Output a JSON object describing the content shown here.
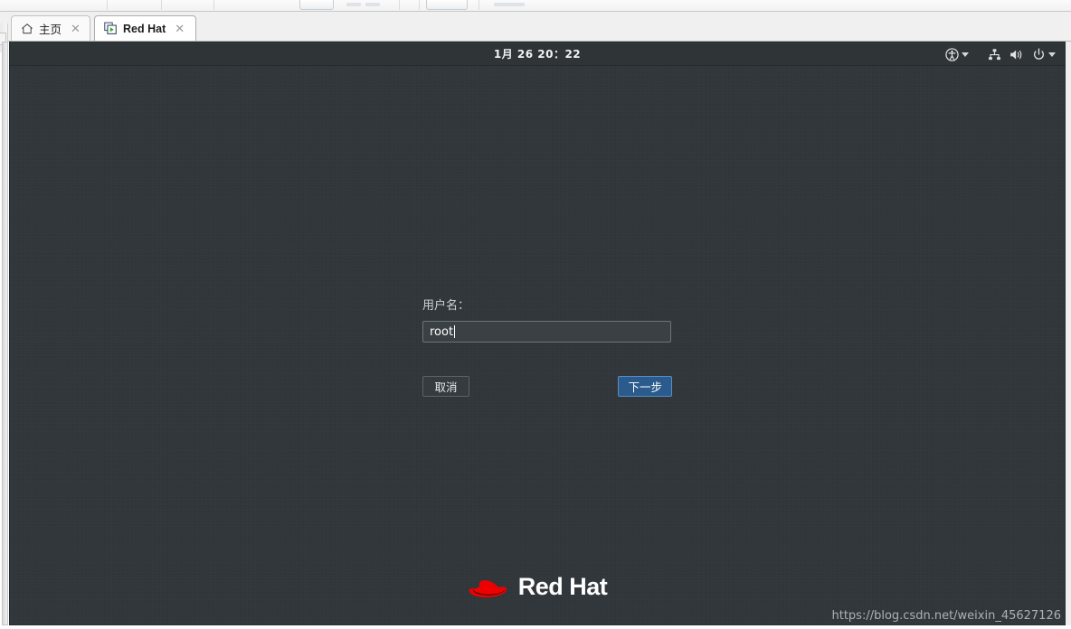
{
  "host": {
    "toolbar": {
      "present": true
    },
    "tabs": [
      {
        "label": "主页",
        "icon": "home-icon",
        "active": false,
        "close_label": "✕"
      },
      {
        "label": "Red Hat",
        "icon": "vm-screen-play-icon",
        "active": true,
        "close_label": "✕"
      }
    ]
  },
  "guest": {
    "panel": {
      "clock": "1月 26  20：22",
      "tray": [
        {
          "name": "accessibility-icon",
          "has_caret": true
        },
        {
          "name": "network-icon",
          "has_caret": false
        },
        {
          "name": "volume-icon",
          "has_caret": false
        },
        {
          "name": "power-icon",
          "has_caret": true
        }
      ]
    },
    "login": {
      "username_label": "用户名：",
      "username_value": "root",
      "username_placeholder": "",
      "cancel_label": "取消",
      "next_label": "下一步"
    },
    "branding": {
      "text": "Red Hat",
      "logo": "red-hat-fedora-logo",
      "logo_color": "#ee0000"
    },
    "watermark": "https://blog.csdn.net/weixin_45627126"
  },
  "colors": {
    "desktop_bg": "#31363a",
    "panel_bg": "#2f3437",
    "accent_blue": "#2a5b8c",
    "brand_red": "#ee0000"
  }
}
